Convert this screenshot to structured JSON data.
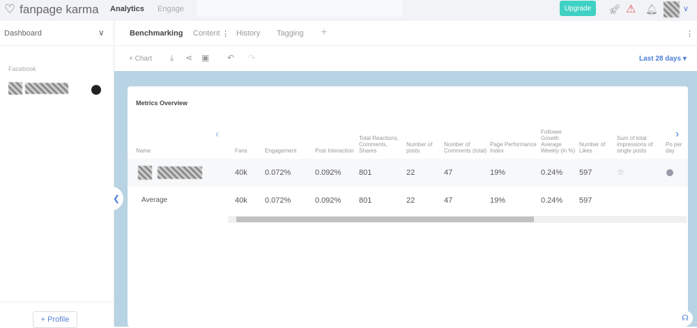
{
  "topbar": {
    "brand": "fanpage karma",
    "nav": [
      "Analytics",
      "Engage"
    ],
    "upgrade": "Upgrade"
  },
  "sidebar": {
    "dashboard": "Dashboard",
    "network": "Facebook",
    "add_profile": "+ Profile"
  },
  "tabs": [
    "Benchmarking",
    "Content",
    "History",
    "Tagging"
  ],
  "toolbar": {
    "add_chart": "+ Chart",
    "date_range": "Last 28 days"
  },
  "card": {
    "title": "Metrics Overview",
    "columns": [
      "Name",
      "Fans",
      "Engagement",
      "Post Interaction",
      "Total Reactions, Comments, Shares",
      "Number of posts",
      "Number of Comments (total)",
      "Page Performance Index",
      "Follower Growth Average Weekly (in %)",
      "Number of Likes",
      "Sum of total impressions of single posts",
      "Po per day"
    ],
    "rows": [
      {
        "name": "",
        "values": [
          "40k",
          "0.072%",
          "0.092%",
          "801",
          "22",
          "47",
          "19%",
          "0.24%",
          "597"
        ]
      },
      {
        "name": "Average",
        "values": [
          "40k",
          "0.072%",
          "0.092%",
          "801",
          "22",
          "47",
          "19%",
          "0.24%",
          "597"
        ]
      }
    ]
  },
  "colors": {
    "accent": "#3fd1c3",
    "link": "#4a7fd8",
    "background": "#b8d3e3"
  }
}
